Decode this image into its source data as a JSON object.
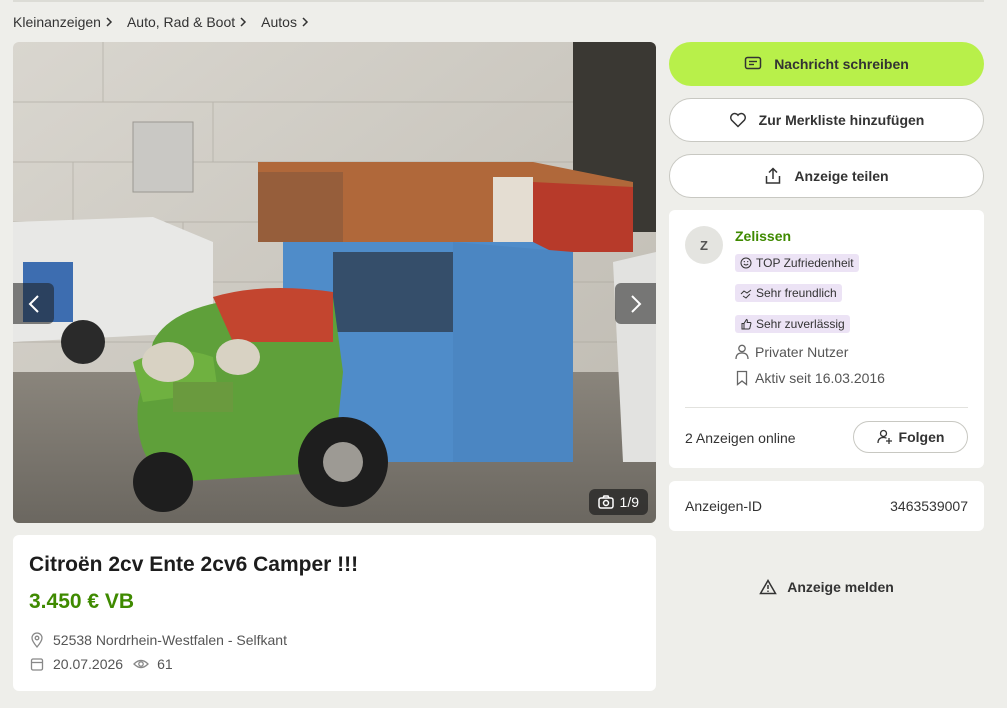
{
  "breadcrumb": [
    {
      "label": "Kleinanzeigen"
    },
    {
      "label": "Auto, Rad & Boot"
    },
    {
      "label": "Autos"
    }
  ],
  "gallery": {
    "counter": "1/9",
    "image_description_icon": "camera-icon"
  },
  "listing": {
    "title": "Citroën 2cv Ente 2cv6 Camper !!!",
    "price": "3.450 € VB",
    "location": "52538 Nordrhein-Westfalen - Selfkant",
    "date": "20.07.2026",
    "views": "61"
  },
  "actions": {
    "message": "Nachricht schreiben",
    "watchlist": "Zur Merkliste hinzufügen",
    "share": "Anzeige teilen"
  },
  "seller": {
    "initial": "Z",
    "name": "Zelissen",
    "badges": [
      "TOP Zufriedenheit",
      "Sehr freundlich",
      "Sehr zuverlässig"
    ],
    "type": "Privater Nutzer",
    "active_since": "Aktiv seit 16.03.2016",
    "online_ads": "2 Anzeigen online",
    "follow": "Folgen"
  },
  "ad_id": {
    "label": "Anzeigen-ID",
    "value": "3463539007"
  },
  "report": "Anzeige melden",
  "colors": {
    "accent": "#b8f04a",
    "price": "#3f8a00",
    "badge_bg": "#ece3f5"
  }
}
